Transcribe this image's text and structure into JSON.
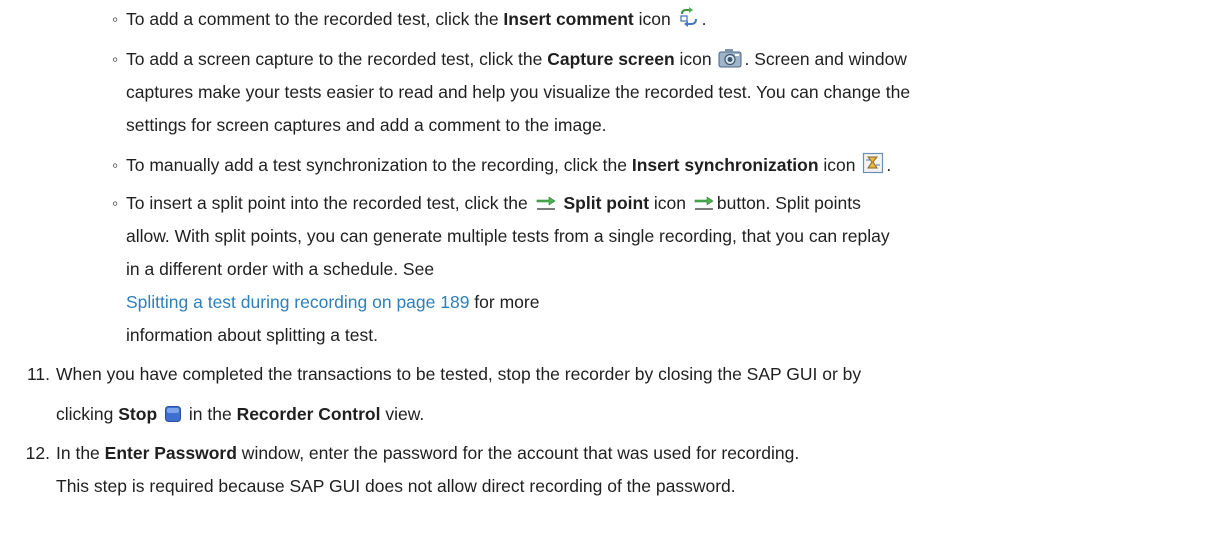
{
  "sub_items": [
    {
      "pre": "To add a comment to the recorded test, click the ",
      "bold": "Insert comment",
      "post": " icon",
      "icon": "insert-comment-icon",
      "end": "."
    },
    {
      "pre": "To add a screen capture to the recorded test, click the ",
      "bold": "Capture screen",
      "post": " icon",
      "icon": "camera-icon",
      "end": ". Screen and window",
      "cont": [
        "captures make your tests easier to read and help you visualize the recorded test. You can change the",
        "settings for screen captures and add a comment to the image."
      ]
    },
    {
      "pre": "To manually add a test synchronization to the recording, click the ",
      "bold": "Insert synchronization",
      "post": " icon",
      "icon": "synchronization-icon",
      "end": "."
    },
    {
      "pre": "To insert a split point into the recorded test, click the",
      "icon_a": "split-point-icon",
      "bold": "Split point",
      "post": " icon",
      "icon_b": "split-point-icon",
      "end": "button. Split points",
      "cont": [
        "allow. With split points, you can generate multiple tests from a single recording, that you can replay",
        "in a different order with a schedule. See"
      ],
      "link": "Splitting a test during recording on page 189",
      "after_link": " for more",
      "cont2": "information about splitting a test."
    }
  ],
  "steps": [
    {
      "number": "11.",
      "line1": "When you have completed the transactions to be tested, stop the recorder by closing the SAP GUI or by",
      "pre": "clicking ",
      "bold1": "Stop",
      "icon": "stop-icon",
      "mid": " in the ",
      "bold2": "Recorder Control",
      "post": " view."
    },
    {
      "number": "12.",
      "pre": "In the ",
      "bold1": "Enter Password",
      "post": " window, enter the password for the account that was used for recording.",
      "line2": "This step is required because SAP GUI does not allow direct recording of the password."
    }
  ],
  "colors": {
    "text": "#1f1f1f",
    "link": "#2f7fb9"
  }
}
